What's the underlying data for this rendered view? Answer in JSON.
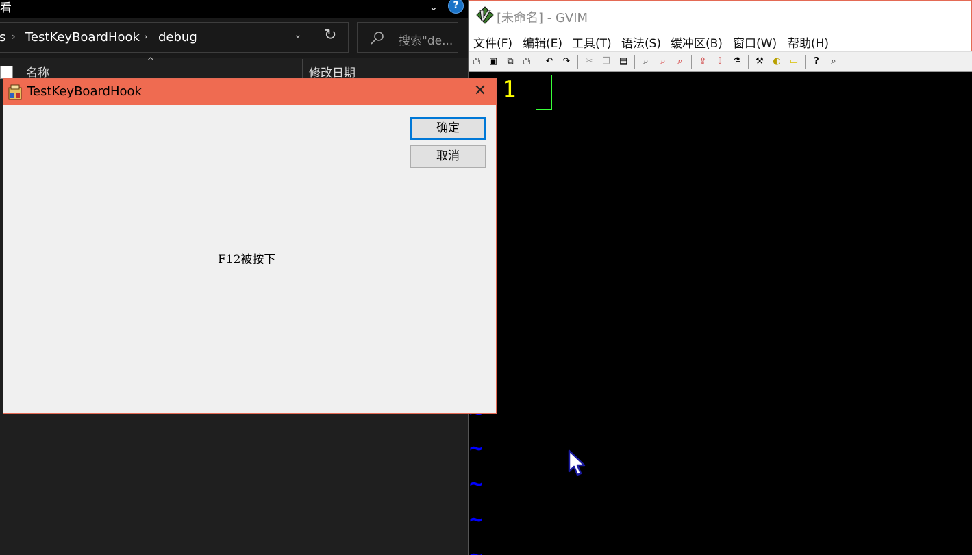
{
  "explorer": {
    "top_fragment": "看",
    "help_glyph": "?",
    "address": {
      "crumbs": [
        "s",
        "TestKeyBoardHook",
        "debug"
      ],
      "dropdown_glyph": "⌄",
      "refresh_glyph": "↻"
    },
    "search": {
      "placeholder": "搜索\"de..."
    },
    "columns": [
      "名称",
      "修改日期"
    ]
  },
  "gvim": {
    "title": "[未命名] - GVIM",
    "menu": [
      "文件(F)",
      "编辑(E)",
      "工具(T)",
      "语法(S)",
      "缓冲区(B)",
      "窗口(W)",
      "帮助(H)"
    ],
    "toolbar": [
      [
        "open-icon",
        "save-icon",
        "save-all-icon",
        "print-icon"
      ],
      [
        "undo-icon",
        "redo-icon"
      ],
      [
        "cut-icon",
        "copy-icon",
        "paste-icon"
      ],
      [
        "find-icon",
        "find-next-icon",
        "find-prev-icon"
      ],
      [
        "load-session-icon",
        "save-session-icon",
        "run-script-icon"
      ],
      [
        "make-icon",
        "shell-icon",
        "tag-jump-icon"
      ],
      [
        "help-icon",
        "find-help-icon"
      ]
    ],
    "line_number": "1",
    "tilde": "~",
    "colors": {
      "line_number": "#ffff00",
      "tilde": "#0000ff",
      "cursor": "#39ff39"
    }
  },
  "dialog": {
    "title": "TestKeyBoardHook",
    "ok_label": "确定",
    "cancel_label": "取消",
    "message": "F12被按下",
    "colors": {
      "titlebar": "#ef6b51",
      "primary_border": "#0078d7"
    }
  }
}
